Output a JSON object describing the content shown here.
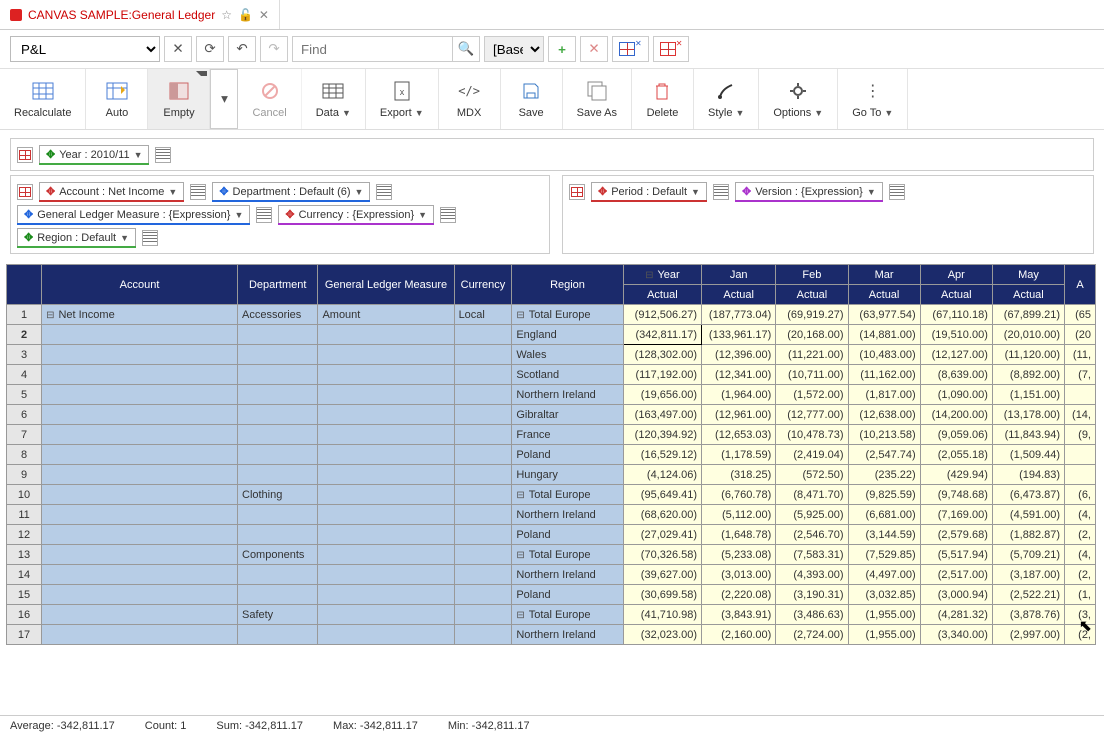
{
  "tab": {
    "title": "CANVAS SAMPLE:General Ledger"
  },
  "toolbar": {
    "pl_option": "P&L",
    "find_placeholder": "Find",
    "base_option": "[Base]"
  },
  "ribbon": {
    "recalculate": "Recalculate",
    "auto": "Auto",
    "empty": "Empty",
    "cancel": "Cancel",
    "data": "Data",
    "export": "Export",
    "mdx": "MDX",
    "save": "Save",
    "saveas": "Save As",
    "delete": "Delete",
    "style": "Style",
    "options": "Options",
    "goto": "Go To"
  },
  "chips": {
    "year": "Year : 2010/11",
    "account": "Account : Net Income",
    "department": "Department : Default (6)",
    "glm": "General Ledger Measure : {Expression}",
    "currency": "Currency : {Expression}",
    "region": "Region : Default",
    "period": "Period : Default",
    "version": "Version : {Expression}"
  },
  "headers": {
    "account": "Account",
    "department": "Department",
    "glm": "General Ledger Measure",
    "currency": "Currency",
    "region": "Region",
    "year": "Year",
    "jan": "Jan",
    "feb": "Feb",
    "mar": "Mar",
    "apr": "Apr",
    "may": "May",
    "actual": "Actual"
  },
  "account_root": "Net Income",
  "dept": {
    "acc": "Accessories",
    "clo": "Clothing",
    "com": "Components",
    "saf": "Safety"
  },
  "glm_val": "Amount",
  "curr_val": "Local",
  "rows": [
    {
      "n": "1",
      "region": "Total Europe",
      "exp": true,
      "y": "(912,506.27)",
      "j": "(187,773.04)",
      "f": "(69,919.27)",
      "m": "(63,977.54)",
      "a": "(67,110.18)",
      "my": "(67,899.21)",
      "t": "(65"
    },
    {
      "n": "2",
      "region": "England",
      "y": "(342,811.17)",
      "j": "(133,961.17)",
      "f": "(20,168.00)",
      "m": "(14,881.00)",
      "a": "(19,510.00)",
      "my": "(20,010.00)",
      "t": "(20"
    },
    {
      "n": "3",
      "region": "Wales",
      "y": "(128,302.00)",
      "j": "(12,396.00)",
      "f": "(11,221.00)",
      "m": "(10,483.00)",
      "a": "(12,127.00)",
      "my": "(11,120.00)",
      "t": "(11,"
    },
    {
      "n": "4",
      "region": "Scotland",
      "y": "(117,192.00)",
      "j": "(12,341.00)",
      "f": "(10,711.00)",
      "m": "(11,162.00)",
      "a": "(8,639.00)",
      "my": "(8,892.00)",
      "t": "(7,"
    },
    {
      "n": "5",
      "region": "Northern Ireland",
      "y": "(19,656.00)",
      "j": "(1,964.00)",
      "f": "(1,572.00)",
      "m": "(1,817.00)",
      "a": "(1,090.00)",
      "my": "(1,151.00)",
      "t": ""
    },
    {
      "n": "6",
      "region": "Gibraltar",
      "y": "(163,497.00)",
      "j": "(12,961.00)",
      "f": "(12,777.00)",
      "m": "(12,638.00)",
      "a": "(14,200.00)",
      "my": "(13,178.00)",
      "t": "(14,"
    },
    {
      "n": "7",
      "region": "France",
      "y": "(120,394.92)",
      "j": "(12,653.03)",
      "f": "(10,478.73)",
      "m": "(10,213.58)",
      "a": "(9,059.06)",
      "my": "(11,843.94)",
      "t": "(9,"
    },
    {
      "n": "8",
      "region": "Poland",
      "y": "(16,529.12)",
      "j": "(1,178.59)",
      "f": "(2,419.04)",
      "m": "(2,547.74)",
      "a": "(2,055.18)",
      "my": "(1,509.44)",
      "t": ""
    },
    {
      "n": "9",
      "region": "Hungary",
      "y": "(4,124.06)",
      "j": "(318.25)",
      "f": "(572.50)",
      "m": "(235.22)",
      "a": "(429.94)",
      "my": "(194.83)",
      "t": ""
    },
    {
      "n": "10",
      "region": "Total Europe",
      "exp": true,
      "dept": "clo",
      "y": "(95,649.41)",
      "j": "(6,760.78)",
      "f": "(8,471.70)",
      "m": "(9,825.59)",
      "a": "(9,748.68)",
      "my": "(6,473.87)",
      "t": "(6,"
    },
    {
      "n": "11",
      "region": "Northern Ireland",
      "y": "(68,620.00)",
      "j": "(5,112.00)",
      "f": "(5,925.00)",
      "m": "(6,681.00)",
      "a": "(7,169.00)",
      "my": "(4,591.00)",
      "t": "(4,"
    },
    {
      "n": "12",
      "region": "Poland",
      "y": "(27,029.41)",
      "j": "(1,648.78)",
      "f": "(2,546.70)",
      "m": "(3,144.59)",
      "a": "(2,579.68)",
      "my": "(1,882.87)",
      "t": "(2,"
    },
    {
      "n": "13",
      "region": "Total Europe",
      "exp": true,
      "dept": "com",
      "y": "(70,326.58)",
      "j": "(5,233.08)",
      "f": "(7,583.31)",
      "m": "(7,529.85)",
      "a": "(5,517.94)",
      "my": "(5,709.21)",
      "t": "(4,"
    },
    {
      "n": "14",
      "region": "Northern Ireland",
      "y": "(39,627.00)",
      "j": "(3,013.00)",
      "f": "(4,393.00)",
      "m": "(4,497.00)",
      "a": "(2,517.00)",
      "my": "(3,187.00)",
      "t": "(2,"
    },
    {
      "n": "15",
      "region": "Poland",
      "y": "(30,699.58)",
      "j": "(2,220.08)",
      "f": "(3,190.31)",
      "m": "(3,032.85)",
      "a": "(3,000.94)",
      "my": "(2,522.21)",
      "t": "(1,"
    },
    {
      "n": "16",
      "region": "Total Europe",
      "exp": true,
      "dept": "saf",
      "y": "(41,710.98)",
      "j": "(3,843.91)",
      "f": "(3,486.63)",
      "m": "(1,955.00)",
      "a": "(4,281.32)",
      "my": "(3,878.76)",
      "t": "(3,"
    },
    {
      "n": "17",
      "region": "Northern Ireland",
      "y": "(32,023.00)",
      "j": "(2,160.00)",
      "f": "(2,724.00)",
      "m": "(1,955.00)",
      "a": "(3,340.00)",
      "my": "(2,997.00)",
      "t": "(2,"
    }
  ],
  "status": {
    "avg": "Average: -342,811.17",
    "count": "Count: 1",
    "sum": "Sum: -342,811.17",
    "max": "Max: -342,811.17",
    "min": "Min: -342,811.17"
  }
}
